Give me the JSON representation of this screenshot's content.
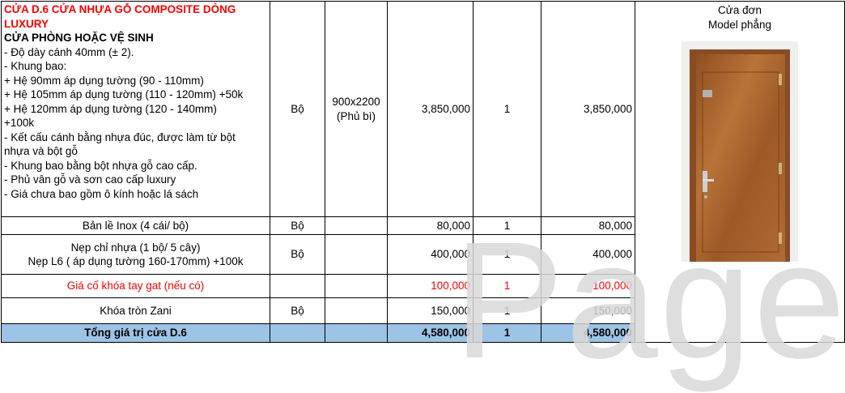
{
  "product": {
    "title": "CỬA D.6 CỬA NHỰA GỖ COMPOSITE DÒNG LUXURY",
    "subtitle": "CỬA PHÒNG HOẶC VỆ SINH",
    "lines": [
      "- Độ dày cánh 40mm (± 2).",
      "- Khung bao:",
      "+ Hệ 90mm áp dụng tường (90 - 110mm)",
      "+ Hệ 105mm áp dụng tường (110 - 120mm) +50k",
      "+ Hệ 120mm áp dụng tường (120 - 140mm)",
      "+100k",
      "- Kết cấu cánh bằng nhựa đúc, được làm từ bột",
      "nhựa và bột gỗ",
      "- Khung bao bằng bột nhựa gỗ cao cấp.",
      "- Phủ vân gỗ và sơn cao cấp luxury",
      "- Giá chưa bao gồm ô kính hoặc lá sách"
    ],
    "unit": "Bộ",
    "size_line1": "900x2200",
    "size_line2": "(Phủ bì)",
    "price": "3,850,000",
    "qty": "1",
    "total": "3,850,000",
    "image_caption_1": "Cửa đơn",
    "image_caption_2": "Model phẳng"
  },
  "rows": [
    {
      "name": "Bản lề Inox  (4 cái/ bộ)",
      "unit": "Bộ",
      "price": "80,000",
      "qty": "1",
      "total": "80,000"
    },
    {
      "name_line1": "Nẹp chỉ nhựa (1 bộ/ 5 cây)",
      "name_line2": "Nẹp L6 ( áp dụng tường 160-170mm) +100k",
      "unit": "Bộ",
      "price": "400,000",
      "qty": "1",
      "total": "400,000"
    },
    {
      "name": "Giá cố khóa tay gat (nếu có)",
      "unit": "",
      "price": "100,000",
      "qty": "1",
      "total": "100,000"
    },
    {
      "name": "Khóa tròn Zani",
      "unit": "Bộ",
      "price": "150,000",
      "qty": "1",
      "total": "150,000"
    }
  ],
  "summary": {
    "label": "Tổng giá trị cửa D.6",
    "price": "4,580,000",
    "qty": "1",
    "total": "4,580,000"
  },
  "watermark": "Page",
  "colors": {
    "title_red": "#ff0000",
    "total_bg": "#9dc3e6",
    "door_wood": "#a8612e"
  }
}
